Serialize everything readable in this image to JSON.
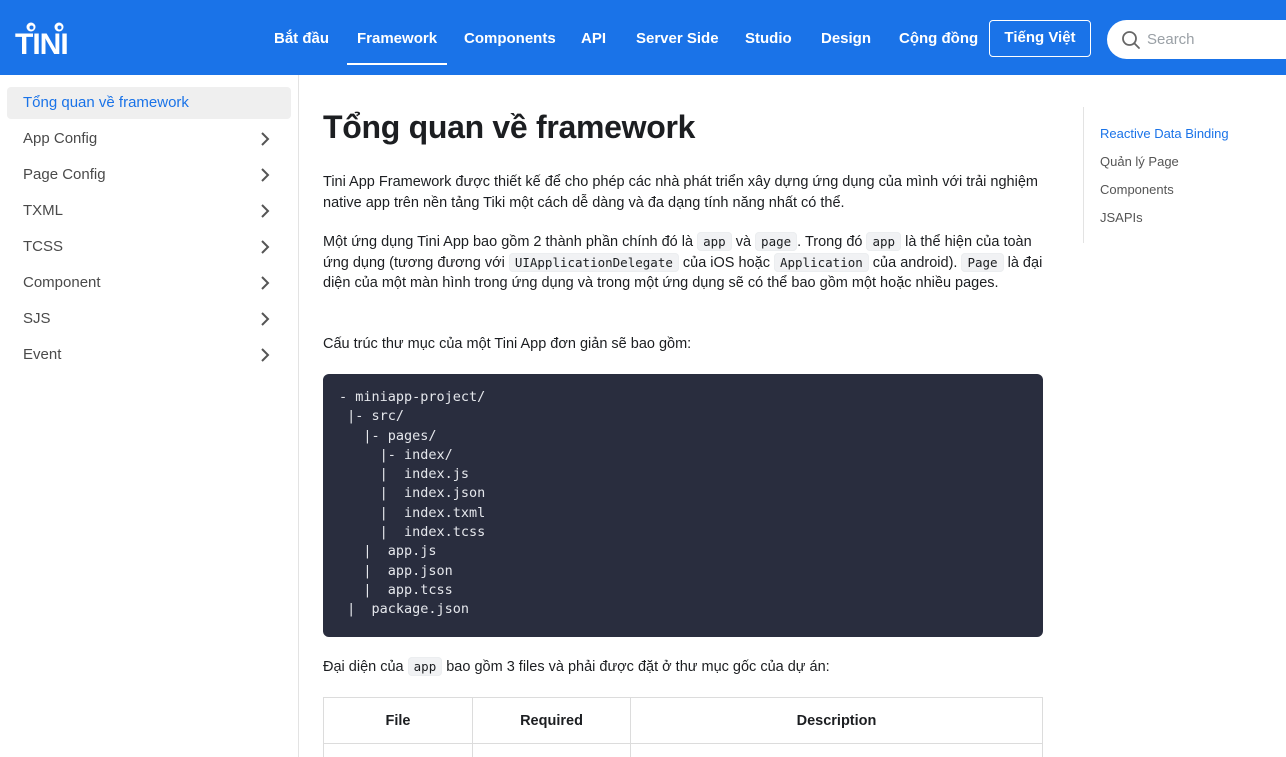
{
  "navbar": {
    "logo_text": "TINI",
    "links": [
      {
        "label": "Bắt đầu",
        "active": false
      },
      {
        "label": "Framework",
        "active": true
      },
      {
        "label": "Components",
        "active": false
      },
      {
        "label": "API",
        "active": false
      },
      {
        "label": "Server Side",
        "active": false
      },
      {
        "label": "Studio",
        "active": false
      },
      {
        "label": "Design",
        "active": false
      },
      {
        "label": "Cộng đồng",
        "active": false
      }
    ],
    "language_button": "Tiếng Việt",
    "search_placeholder": "Search",
    "search_value": ""
  },
  "sidebar": {
    "items": [
      {
        "label": "Tổng quan về framework",
        "active": true,
        "expandable": false
      },
      {
        "label": "App Config",
        "active": false,
        "expandable": true
      },
      {
        "label": "Page Config",
        "active": false,
        "expandable": true
      },
      {
        "label": "TXML",
        "active": false,
        "expandable": true
      },
      {
        "label": "TCSS",
        "active": false,
        "expandable": true
      },
      {
        "label": "Component",
        "active": false,
        "expandable": true
      },
      {
        "label": "SJS",
        "active": false,
        "expandable": true
      },
      {
        "label": "Event",
        "active": false,
        "expandable": true
      }
    ]
  },
  "content": {
    "title": "Tổng quan về framework",
    "intro": "Tini App Framework được thiết kế để cho phép các nhà phát triển xây dựng ứng dụng của mình với trải nghiệm native app trên nền tảng Tiki một cách dễ dàng và đa dạng tính năng nhất có thể.",
    "p2": {
      "t1": "Một ứng dụng Tini App bao gồm 2 thành phần chính đó là ",
      "c1": "app",
      "t2": " và ",
      "c2": "page",
      "t3": ". Trong đó ",
      "c3": "app",
      "t4": " là thể hiện của toàn ứng dụng (tương đương với ",
      "c4": "UIApplicationDelegate",
      "t5": " của iOS hoặc ",
      "c5": "Application",
      "t6": " của android). ",
      "c6": "Page",
      "t7": " là đại diện của một màn hình trong ứng dụng và trong một ứng dụng sẽ có thể bao gồm một hoặc nhiều pages."
    },
    "p3": "Cấu trúc thư mục của một Tini App đơn giản sẽ bao gồm:",
    "code_lines": [
      "- miniapp-project/",
      " |- src/",
      "   |- pages/",
      "     |- index/",
      "     |  index.js",
      "     |  index.json",
      "     |  index.txml",
      "     |  index.tcss",
      "   |  app.js",
      "   |  app.json",
      "   |  app.tcss",
      " |  package.json"
    ],
    "p4": {
      "t1": "Đại diện của ",
      "c1": "app",
      "t2": " bao gồm 3 files và phải được đặt ở thư mục gốc của dự án:"
    },
    "table": {
      "headers": [
        "File",
        "Required",
        "Description"
      ]
    }
  },
  "toc": {
    "items": [
      {
        "label": "Reactive Data Binding",
        "active": true
      },
      {
        "label": "Quản lý Page",
        "active": false
      },
      {
        "label": "Components",
        "active": false
      },
      {
        "label": "JSAPIs",
        "active": false
      }
    ]
  },
  "colors": {
    "brand": "#1a73e8",
    "code_bg": "#292d3e"
  }
}
